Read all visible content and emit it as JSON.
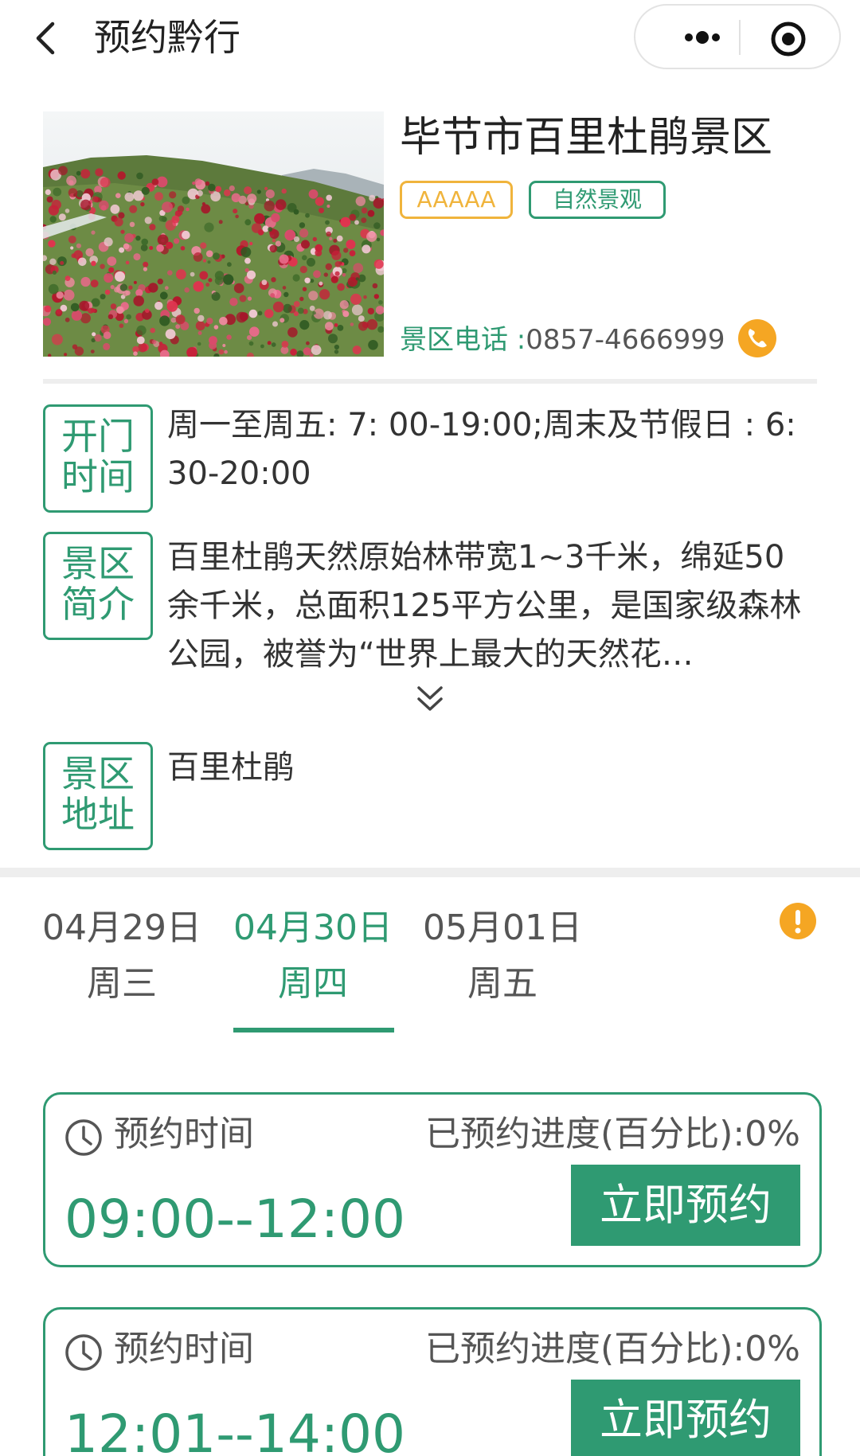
{
  "nav": {
    "title": "预约黔行"
  },
  "scenic": {
    "name": "毕节市百里杜鹃景区",
    "tags": [
      "AAAAA",
      "自然景观"
    ],
    "phone_label": "景区电话 :",
    "phone": "0857-4666999"
  },
  "info": {
    "hours_label": [
      "开门",
      "时间"
    ],
    "hours_text": "周一至周五: 7: 00-19:00;周末及节假日 : 6: 30-20:00",
    "intro_label": [
      "景区",
      "简介"
    ],
    "intro_text": "百里杜鹃天然原始林带宽1~3千米，绵延50余千米，总面积125平方公里，是国家级森林公园，被誉为“世界上最大的天然花…",
    "address_label": [
      "景区",
      "地址"
    ],
    "address_text": "百里杜鹃"
  },
  "dates": [
    {
      "date": "04月29日",
      "weekday": "周三"
    },
    {
      "date": "04月30日",
      "weekday": "周四",
      "active": true
    },
    {
      "date": "05月01日",
      "weekday": "周五"
    }
  ],
  "slots": [
    {
      "label": "预约时间",
      "progress": "已预约进度(百分比):0%",
      "time": "09:00--12:00",
      "button": "立即预约"
    },
    {
      "label": "预约时间",
      "progress": "已预约进度(百分比):0%",
      "time": "12:01--14:00",
      "button": "立即预约"
    }
  ],
  "colors": {
    "accent": "#2f9a72",
    "gold": "#f0b43c",
    "alert": "#f5a623"
  },
  "icons": {
    "back": "back-icon",
    "more": "more-icon",
    "target": "target-icon",
    "phone": "phone-icon",
    "expand": "double-chevron-down-icon",
    "alert": "alert-icon",
    "clock": "clock-icon"
  }
}
